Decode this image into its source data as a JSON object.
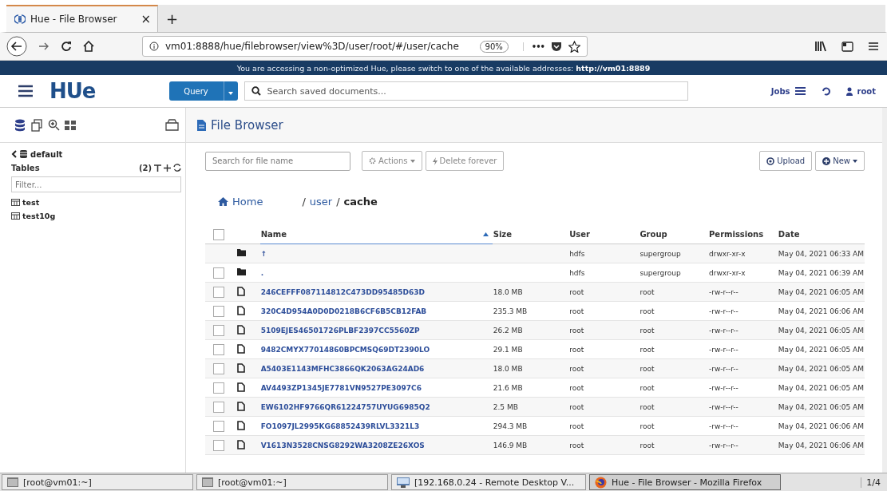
{
  "browser": {
    "tabs": [
      {
        "title": "Hue - File Browser",
        "selected": true
      }
    ],
    "new_tab": "+",
    "close": "×",
    "url": "vm01:8888/hue/filebrowser/view%3D/user/root/#/user/cache",
    "zoom": "90%",
    "more": "•••"
  },
  "banner": {
    "text": "You are accessing a non-optimized Hue, please switch to one of the available addresses: ",
    "link": "http://vm01:8889"
  },
  "header": {
    "logo": "HUe",
    "query_button": "Query",
    "search": {
      "placeholder": "Search saved documents..."
    },
    "jobs": "Jobs",
    "user": "root"
  },
  "sidebar": {
    "database": "default",
    "tables_label": "Tables",
    "count": "(2)",
    "filter": {
      "placeholder": "Filter..."
    },
    "tables": [
      {
        "name": "test",
        "selected": false
      },
      {
        "name": "test10g",
        "selected": false
      }
    ]
  },
  "file_browser": {
    "title": "File Browser",
    "search": {
      "placeholder": "Search for file name"
    },
    "actions_button": "Actions",
    "delete_button": "Delete forever",
    "upload_button": "Upload",
    "new_button": "New",
    "breadcrumb": {
      "home": "Home",
      "parts": [
        {
          "separator": "/",
          "label": "user",
          "current": false
        },
        {
          "separator": "/",
          "label": "cache",
          "current": true
        }
      ]
    },
    "select_all": {
      "checked": false
    },
    "table": {
      "columns": [
        {
          "label": "Name",
          "sorted": true
        },
        {
          "label": "Size",
          "sorted": false
        },
        {
          "label": "User",
          "sorted": false
        },
        {
          "label": "Group",
          "sorted": false
        },
        {
          "label": "Permissions",
          "sorted": false
        },
        {
          "label": "Date",
          "sorted": false
        }
      ],
      "rows": [
        {
          "kind": "folder",
          "name": "↑",
          "size": "",
          "user": "hdfs",
          "group": "supergroup",
          "permissions": "drwxr-xr-x",
          "date": "May 04, 2021 06:33 AM"
        },
        {
          "kind": "folder",
          "checked": false,
          "name": ".",
          "size": "",
          "user": "hdfs",
          "group": "supergroup",
          "permissions": "drwxr-xr-x",
          "date": "May 04, 2021 06:39 AM"
        },
        {
          "kind": "file",
          "checked": false,
          "name": "246CEFFF087114812C473DD95485D63D",
          "size": "18.0 MB",
          "user": "root",
          "group": "root",
          "permissions": "-rw-r--r--",
          "date": "May 04, 2021 06:05 AM"
        },
        {
          "kind": "file",
          "checked": false,
          "name": "320C4D954A0D0D0218B6CF6B5CB12FAB",
          "size": "235.3 MB",
          "user": "root",
          "group": "root",
          "permissions": "-rw-r--r--",
          "date": "May 04, 2021 06:06 AM"
        },
        {
          "kind": "file",
          "checked": false,
          "name": "5109EJES46501726PLBF2397CC5560ZP",
          "size": "26.2 MB",
          "user": "root",
          "group": "root",
          "permissions": "-rw-r--r--",
          "date": "May 04, 2021 06:05 AM"
        },
        {
          "kind": "file",
          "checked": false,
          "name": "9482CMYX77014860BPCMSQ69DT2390LO",
          "size": "29.1 MB",
          "user": "root",
          "group": "root",
          "permissions": "-rw-r--r--",
          "date": "May 04, 2021 06:05 AM"
        },
        {
          "kind": "file",
          "checked": false,
          "name": "A5403E1143MFHC3866QK2063AG24AD6",
          "size": "18.0 MB",
          "user": "root",
          "group": "root",
          "permissions": "-rw-r--r--",
          "date": "May 04, 2021 06:05 AM"
        },
        {
          "kind": "file",
          "checked": false,
          "name": "AV4493ZP1345JE7781VN9527PE3097C6",
          "size": "21.6 MB",
          "user": "root",
          "group": "root",
          "permissions": "-rw-r--r--",
          "date": "May 04, 2021 06:05 AM"
        },
        {
          "kind": "file",
          "checked": false,
          "name": "EW6102HF9766QR61224757UYUG6985Q2",
          "size": "2.5 MB",
          "user": "root",
          "group": "root",
          "permissions": "-rw-r--r--",
          "date": "May 04, 2021 06:05 AM"
        },
        {
          "kind": "file",
          "checked": false,
          "name": "FO1097JL2995KG68852439RLVL3321L3",
          "size": "294.3 MB",
          "user": "root",
          "group": "root",
          "permissions": "-rw-r--r--",
          "date": "May 04, 2021 06:06 AM"
        },
        {
          "kind": "file",
          "checked": false,
          "name": "V1613N3528CNSG8292WA3208ZE26XOS",
          "size": "146.9 MB",
          "user": "root",
          "group": "root",
          "permissions": "-rw-r--r--",
          "date": "May 04, 2021 06:06 AM"
        }
      ]
    }
  },
  "taskbar": {
    "items": [
      {
        "label": "[root@vm01:~]",
        "kind": "terminal",
        "selected": false
      },
      {
        "label": "[root@vm01:~]",
        "kind": "terminal",
        "selected": false
      },
      {
        "label": "[192.168.0.24 - Remote Desktop V...",
        "kind": "remote",
        "selected": false
      },
      {
        "label": "Hue - File Browser - Mozilla Firefox",
        "kind": "browser",
        "selected": true
      }
    ],
    "pager": "1/4"
  }
}
